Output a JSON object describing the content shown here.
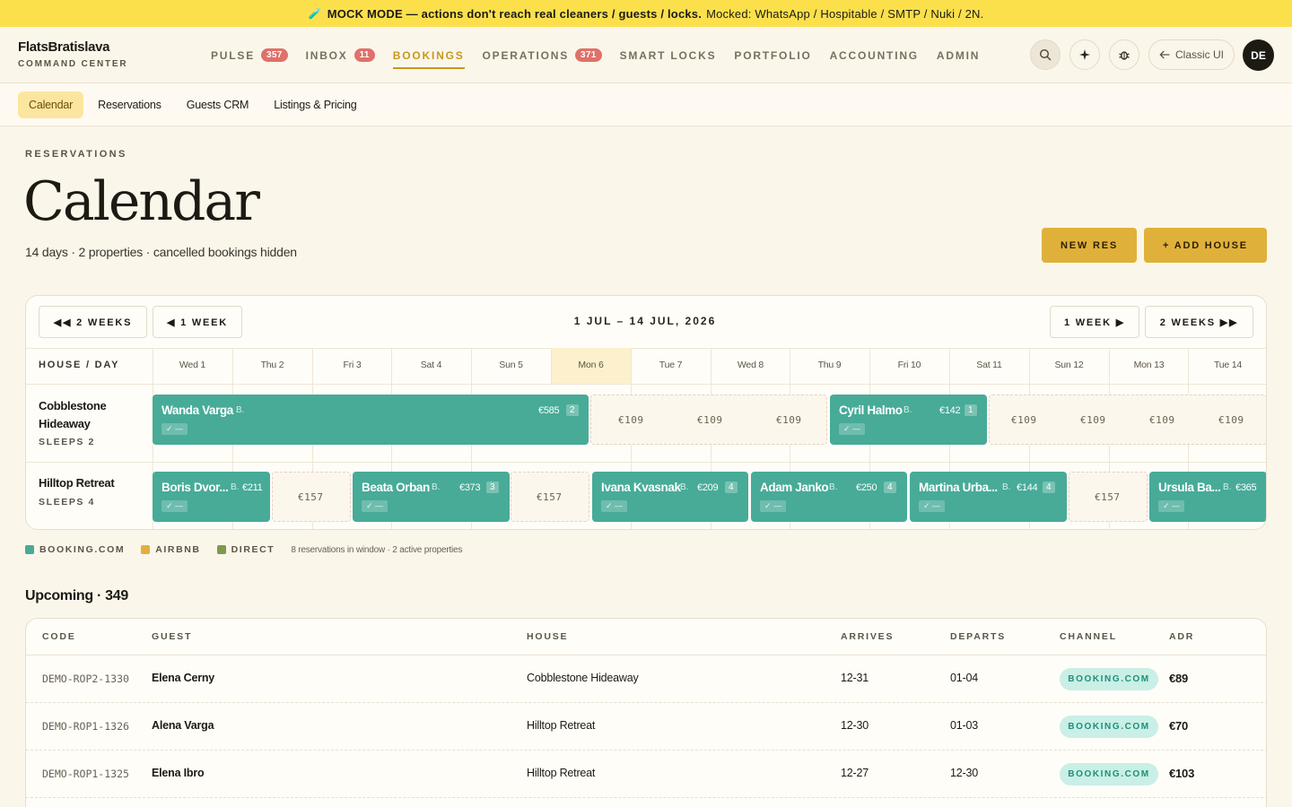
{
  "banner": {
    "icon": "🧪",
    "bold": "MOCK MODE — actions don't reach real cleaners / guests / locks.",
    "rest": "Mocked: WhatsApp / Hospitable / SMTP / Nuki / 2N."
  },
  "brand": {
    "name": "FlatsBratislava",
    "subtitle": "COMMAND CENTER"
  },
  "nav": [
    {
      "label": "PULSE",
      "badge": "357",
      "active": false
    },
    {
      "label": "INBOX",
      "badge": "11",
      "active": false
    },
    {
      "label": "BOOKINGS",
      "badge": null,
      "active": true
    },
    {
      "label": "OPERATIONS",
      "badge": "371",
      "active": false
    },
    {
      "label": "SMART LOCKS",
      "badge": null,
      "active": false
    },
    {
      "label": "PORTFOLIO",
      "badge": null,
      "active": false
    },
    {
      "label": "ACCOUNTING",
      "badge": null,
      "active": false
    },
    {
      "label": "ADMIN",
      "badge": null,
      "active": false
    }
  ],
  "header_actions": {
    "classic_label": "Classic UI",
    "avatar": "DE"
  },
  "subnav": [
    {
      "label": "Calendar",
      "active": true
    },
    {
      "label": "Reservations",
      "active": false
    },
    {
      "label": "Guests CRM",
      "active": false
    },
    {
      "label": "Listings & Pricing",
      "active": false
    }
  ],
  "page": {
    "eyebrow": "RESERVATIONS",
    "title": "Calendar",
    "subtitle": "14 days · 2 properties · cancelled bookings hidden",
    "new_res": "NEW RES",
    "add_house": "+ ADD HOUSE"
  },
  "calendar": {
    "prev2": "◀◀ 2 WEEKS",
    "prev1": "◀ 1 WEEK",
    "range": "1 JUL – 14 JUL, 2026",
    "next1": "1 WEEK ▶",
    "next2": "2 WEEKS ▶▶",
    "col_header": "HOUSE / DAY",
    "days": [
      "Wed 1",
      "Thu 2",
      "Fri 3",
      "Sat 4",
      "Sun 5",
      "Mon 6",
      "Tue 7",
      "Wed 8",
      "Thu 9",
      "Fri 10",
      "Sat 11",
      "Sun 12",
      "Mon 13",
      "Tue 14"
    ],
    "today": "Mon 6",
    "properties": [
      {
        "name": "Cobblestone Hideaway",
        "sleeps": "SLEEPS 2"
      },
      {
        "name": "Hilltop Retreat",
        "sleeps": "SLEEPS 4"
      }
    ],
    "bookings": [
      {
        "guest": "Wanda Varga",
        "channel": "B.",
        "price": "€585",
        "nights": "2",
        "chip": "✓ —"
      },
      {
        "guest": "Cyril Halmo",
        "channel": "B.",
        "price": "€142",
        "nights": "1",
        "chip": "✓ —"
      },
      {
        "guest": "Boris Dvor...",
        "channel": "B.",
        "price": "€211",
        "nights": "",
        "chip": "✓ —"
      },
      {
        "guest": "Beata Orban",
        "channel": "B.",
        "price": "€373",
        "nights": "3",
        "chip": "✓ —"
      },
      {
        "guest": "Ivana Kvasnak",
        "channel": "B.",
        "price": "€209",
        "nights": "4",
        "chip": "✓ —"
      },
      {
        "guest": "Adam Janko",
        "channel": "B.",
        "price": "€250",
        "nights": "4",
        "chip": "✓ —"
      },
      {
        "guest": "Martina Urba...",
        "channel": "B.",
        "price": "€144",
        "nights": "4",
        "chip": "✓ —"
      },
      {
        "guest": "Ursula Ba...",
        "channel": "B.",
        "price": "€365",
        "nights": "",
        "chip": "✓ —"
      }
    ],
    "free_prices": {
      "row1a": [
        "€109",
        "€109",
        "€109"
      ],
      "row1b": [
        "€109",
        "€109",
        "€109",
        "€109"
      ],
      "row2": [
        "€157",
        "€157",
        "€157"
      ]
    }
  },
  "legend": {
    "items": [
      {
        "label": "BOOKING.COM",
        "color": "#47ab98"
      },
      {
        "label": "AIRBNB",
        "color": "#e0b13a"
      },
      {
        "label": "DIRECT",
        "color": "#7e9a4e"
      }
    ],
    "note": "8 reservations in window · 2 active properties"
  },
  "upcoming": {
    "title": "Upcoming · 349",
    "columns": [
      "CODE",
      "GUEST",
      "HOUSE",
      "ARRIVES",
      "DEPARTS",
      "CHANNEL",
      "ADR"
    ],
    "rows": [
      {
        "code": "DEMO-ROP2-1330",
        "guest": "Elena Cerny",
        "house": "Cobblestone Hideaway",
        "arrives": "12-31",
        "departs": "01-04",
        "channel": "BOOKING.COM",
        "adr": "€89"
      },
      {
        "code": "DEMO-ROP1-1326",
        "guest": "Alena Varga",
        "house": "Hilltop Retreat",
        "arrives": "12-30",
        "departs": "01-03",
        "channel": "BOOKING.COM",
        "adr": "€70"
      },
      {
        "code": "DEMO-ROP1-1325",
        "guest": "Elena Ibro",
        "house": "Hilltop Retreat",
        "arrives": "12-27",
        "departs": "12-30",
        "channel": "BOOKING.COM",
        "adr": "€103"
      }
    ]
  }
}
